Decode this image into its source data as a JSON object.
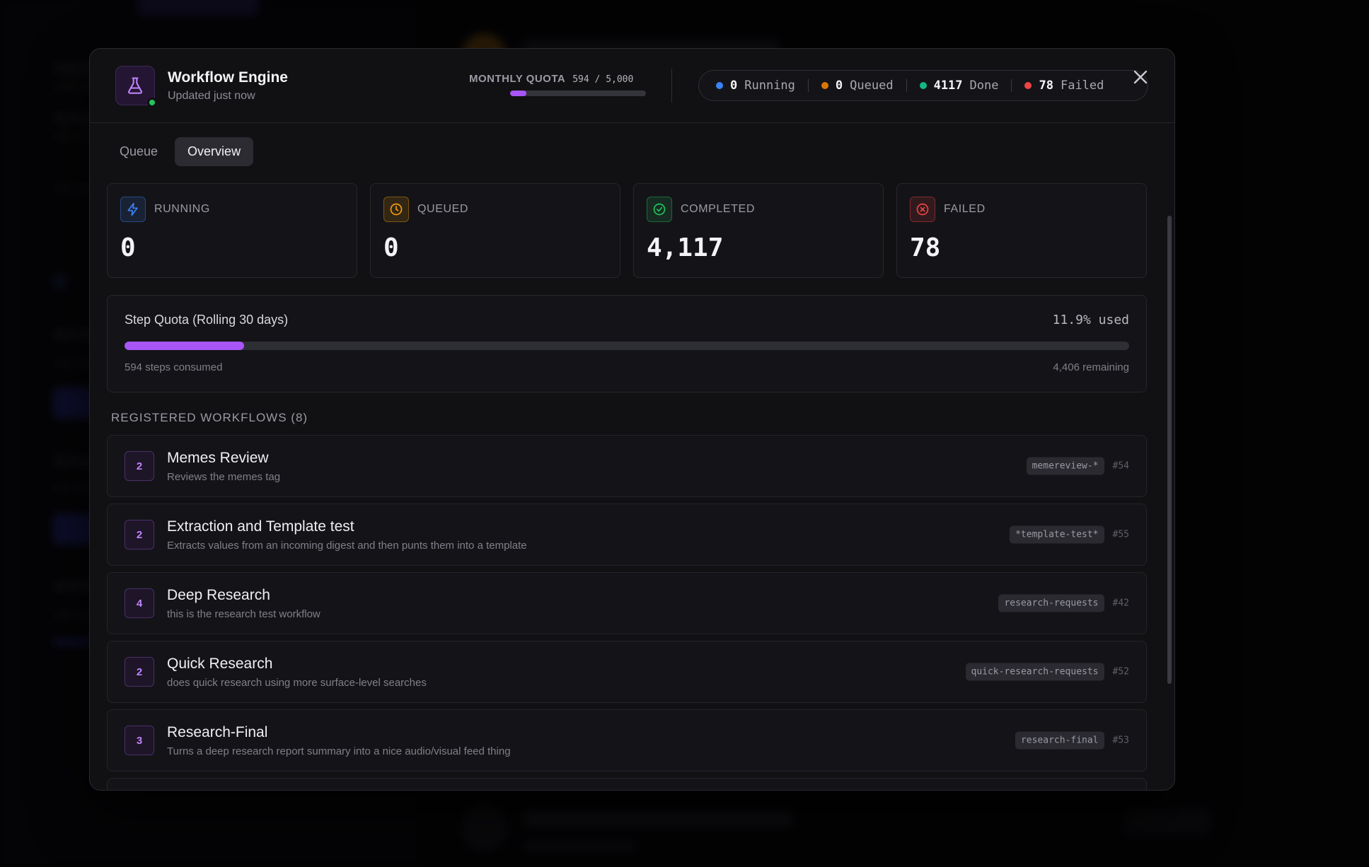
{
  "modal": {
    "title": "Workflow Engine",
    "subtitle": "Updated just now",
    "quota_label": "MONTHLY QUOTA",
    "quota_value": "594 / 5,000",
    "quota_fraction": 0.119
  },
  "status": [
    {
      "count": "0",
      "label": "Running",
      "color": "#3b82f6"
    },
    {
      "count": "0",
      "label": "Queued",
      "color": "#d97706"
    },
    {
      "count": "4117",
      "label": "Done",
      "color": "#10b981"
    },
    {
      "count": "78",
      "label": "Failed",
      "color": "#ef4444"
    }
  ],
  "tabs": [
    {
      "label": "Queue",
      "active": false
    },
    {
      "label": "Overview",
      "active": true
    }
  ],
  "cards": [
    {
      "label": "RUNNING",
      "value": "0",
      "icon": "bolt-icon",
      "color": "#3b82f6"
    },
    {
      "label": "QUEUED",
      "value": "0",
      "icon": "clock-icon",
      "color": "#f59e0b"
    },
    {
      "label": "COMPLETED",
      "value": "4,117",
      "icon": "check-circle-icon",
      "color": "#22c55e"
    },
    {
      "label": "FAILED",
      "value": "78",
      "icon": "x-circle-icon",
      "color": "#ef4444"
    }
  ],
  "step_quota": {
    "title": "Step Quota (Rolling 30 days)",
    "used_text": "11.9% used",
    "used_fraction": 0.119,
    "consumed": "594 steps consumed",
    "remaining": "4,406 remaining"
  },
  "workflows_title": "REGISTERED WORKFLOWS (8)",
  "workflows": [
    {
      "steps": "2",
      "name": "Memes Review",
      "desc": "Reviews the memes tag",
      "tag": "memereview-*",
      "id": "#54"
    },
    {
      "steps": "2",
      "name": "Extraction and Template test",
      "desc": "Extracts values from an incoming digest and then punts them into a template",
      "tag": "*template-test*",
      "id": "#55"
    },
    {
      "steps": "4",
      "name": "Deep Research",
      "desc": "this is the research test workflow",
      "tag": "research-requests",
      "id": "#42"
    },
    {
      "steps": "2",
      "name": "Quick Research",
      "desc": "does quick research using more surface-level searches",
      "tag": "quick-research-requests",
      "id": "#52"
    },
    {
      "steps": "3",
      "name": "Research-Final",
      "desc": "Turns a deep research report summary into a nice audio/visual feed thing",
      "tag": "research-final",
      "id": "#53"
    }
  ]
}
